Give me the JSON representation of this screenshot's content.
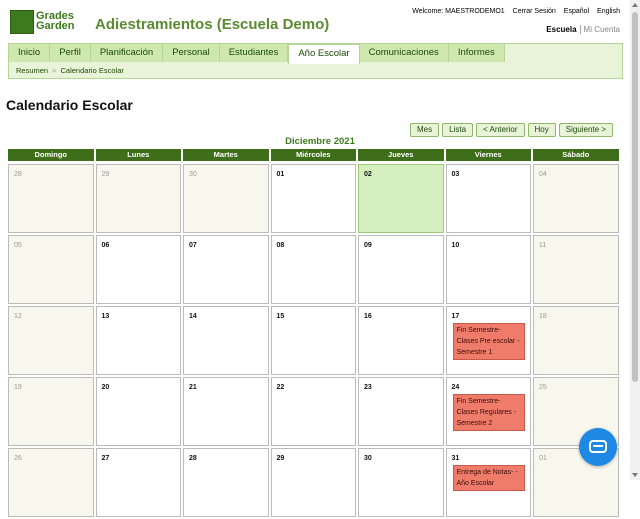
{
  "header": {
    "logo_text": "Grades Garden",
    "school_title": "Adiestramientos (Escuela Demo)",
    "welcome": "Welcome: MAESTRODEMO1",
    "logout": "Cerrar Sesión",
    "lang_es": "Español",
    "lang_en": "English",
    "escuela": "Escuela",
    "mi_cuenta": "Mi Cuenta"
  },
  "tabs": [
    {
      "label": "Inicio"
    },
    {
      "label": "Perfil"
    },
    {
      "label": "Planificación"
    },
    {
      "label": "Personal"
    },
    {
      "label": "Estudiantes"
    },
    {
      "label": "Año Escolar"
    },
    {
      "label": "Comunicaciones"
    },
    {
      "label": "Informes"
    }
  ],
  "active_tab": "Año Escolar",
  "breadcrumb": {
    "root": "Resumen",
    "sep": ">",
    "current": "Calendario Escolar"
  },
  "page_title": "Calendario Escolar",
  "toolbar": {
    "mes": "Mes",
    "lista": "Lista",
    "anterior": "< Anterior",
    "hoy": "Hoy",
    "siguiente": "Siguiente >"
  },
  "month_title": "Diciembre 2021",
  "weekdays": [
    "Domingo",
    "Lunes",
    "Martes",
    "Miércoles",
    "Jueves",
    "Viernes",
    "Sábado"
  ],
  "weeks": [
    [
      "28",
      "29",
      "30",
      "01",
      "02",
      "03",
      "04"
    ],
    [
      "05",
      "06",
      "07",
      "08",
      "09",
      "10",
      "11"
    ],
    [
      "12",
      "13",
      "14",
      "15",
      "16",
      "17",
      "18"
    ],
    [
      "19",
      "20",
      "21",
      "22",
      "23",
      "24",
      "25"
    ],
    [
      "26",
      "27",
      "28",
      "29",
      "30",
      "31",
      "01"
    ]
  ],
  "events": {
    "friday_week3": "Fin Semestre-Clases Pre escolar - Semestre 1",
    "friday_week4": "Fin Semestre-Clases Regulares - Semestre 2",
    "friday_week5": "Entrega de Notas- - Año Escolar"
  },
  "colors": {
    "brand_green": "#3e6e19",
    "event_red": "#ef7b6b",
    "today_green": "#d5efbf",
    "chat_blue": "#1e88e5"
  },
  "icons": {
    "chat": "chat-icon",
    "logo": "grades-garden-logo"
  }
}
